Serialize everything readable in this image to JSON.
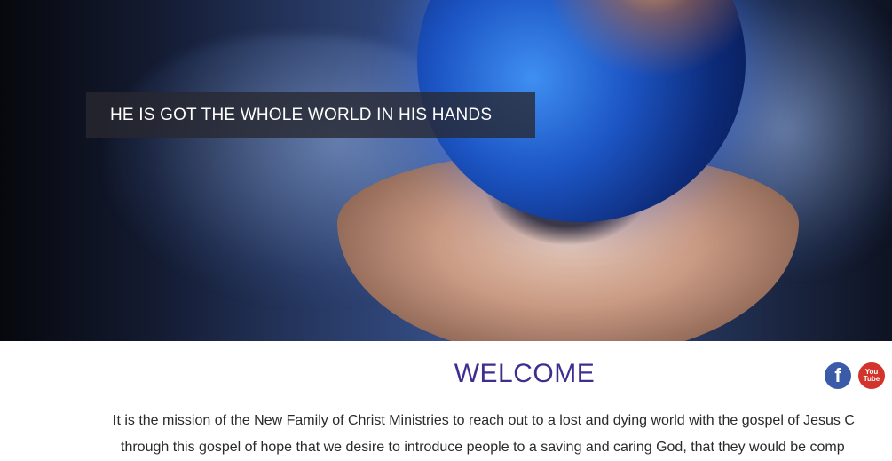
{
  "hero": {
    "tagline": "HE IS GOT THE WHOLE WORLD IN HIS HANDS"
  },
  "welcome": {
    "heading": "WELCOME",
    "mission_line_1": "It is the mission of the New Family of Christ Ministries to reach out to a lost and dying world with the gospel of Jesus C",
    "mission_line_2": "through this gospel of hope that we desire to introduce people to a saving and caring God, that they would be comp"
  },
  "social": {
    "facebook_glyph": "f",
    "youtube_top": "You",
    "youtube_bottom": "Tube",
    "colors": {
      "facebook": "#3b5ba8",
      "youtube": "#d2332a"
    }
  },
  "colors": {
    "heading": "#3d2f8f",
    "tagline_text": "#ffffff",
    "body_text": "#2a2a2a"
  }
}
